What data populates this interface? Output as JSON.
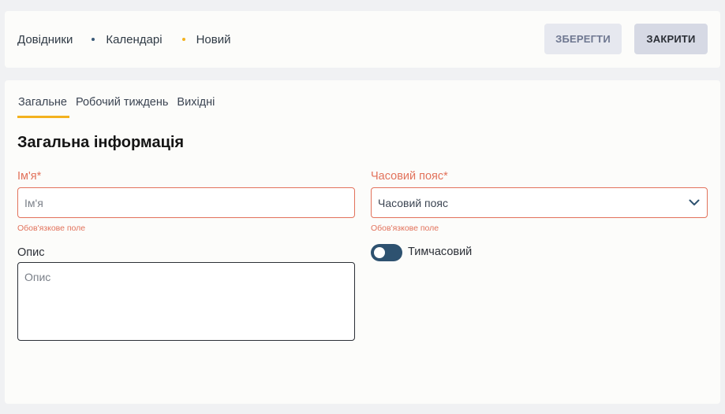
{
  "breadcrumb": {
    "items": [
      "Довідники",
      "Календарі",
      "Новий"
    ]
  },
  "toolbar": {
    "save_label": "ЗБЕРЕГТИ",
    "close_label": "ЗАКРИТИ"
  },
  "tabs": [
    {
      "label": "Загальне",
      "active": true
    },
    {
      "label": "Робочий тиждень",
      "active": false
    },
    {
      "label": "Вихідні",
      "active": false
    }
  ],
  "section": {
    "title": "Загальна інформація"
  },
  "form": {
    "name": {
      "label": "Ім'я*",
      "placeholder": "Ім'я",
      "value": "",
      "error": "Обов'язкове поле"
    },
    "timezone": {
      "label": "Часовий пояс*",
      "placeholder": "Часовий пояс",
      "error": "Обов'язкове поле"
    },
    "description": {
      "label": "Опис",
      "placeholder": "Опис",
      "value": ""
    },
    "temporary": {
      "label": "Тимчасовий",
      "checked": false
    }
  },
  "colors": {
    "accent": "#f3b21f",
    "error": "#e2725b",
    "toggle": "#2e5270",
    "page_bg": "#f0f1f3",
    "card_bg": "#fcfcfa"
  },
  "icons": {
    "breadcrumb_separator": "dot",
    "timezone_dropdown": "chevron-down-icon"
  }
}
